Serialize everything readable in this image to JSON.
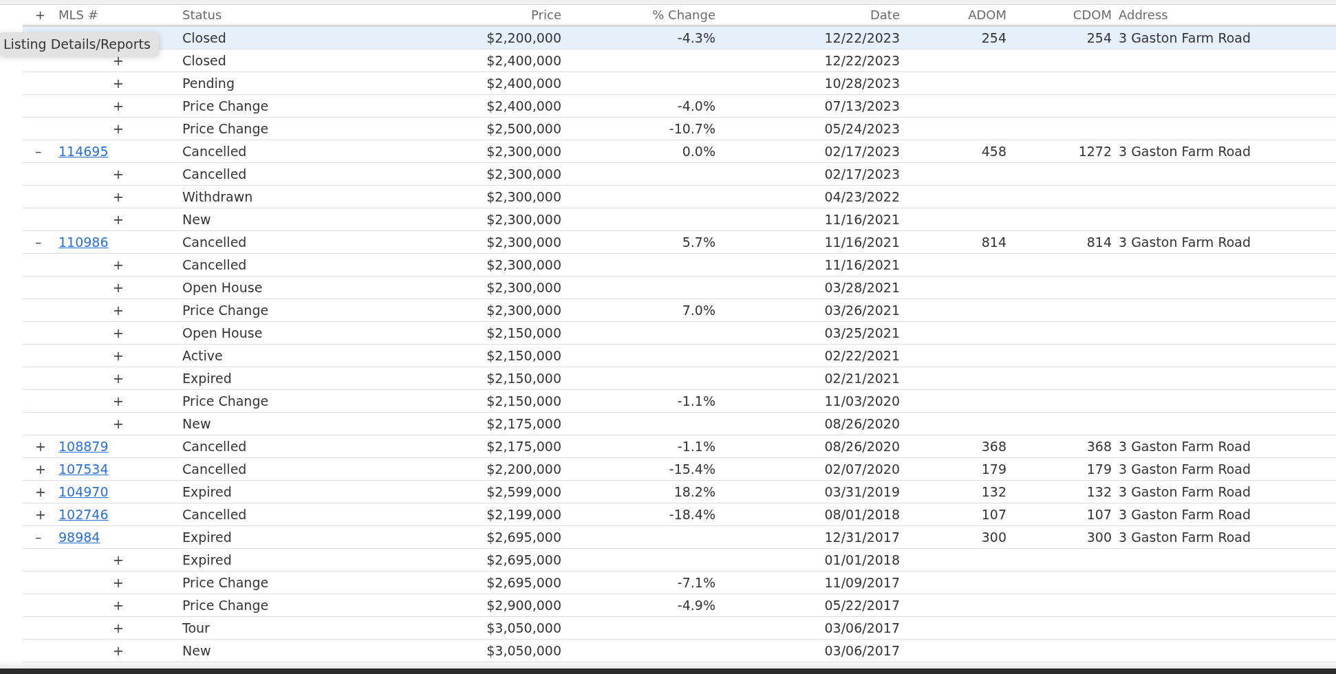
{
  "table": {
    "header": {
      "toggle": "+",
      "columns": [
        "MLS #",
        "Status",
        "Price",
        "% Change",
        "Date",
        "ADOM",
        "CDOM",
        "Address"
      ]
    },
    "listings": [
      {
        "selected": true,
        "status": "Closed",
        "price": "$2,200,000",
        "change": "-4.3%",
        "date": "12/22/2023",
        "adom": "254",
        "cdom": "254",
        "address": "3 Gaston Farm Road",
        "children": [
          {
            "toggle": "+",
            "selected": false,
            "status": "Closed",
            "price": "$2,400,000",
            "date": "12/22/2023"
          },
          {
            "toggle": "+",
            "selected": false,
            "status": "Pending",
            "price": "$2,400,000",
            "date": "10/28/2023"
          },
          {
            "toggle": "+",
            "selected": false,
            "status": "Price Change",
            "price": "$2,400,000",
            "change": "-4.0%",
            "date": "07/13/2023"
          },
          {
            "toggle": "+",
            "selected": false,
            "status": "Price Change",
            "price": "$2,500,000",
            "change": "-10.7%",
            "date": "05/24/2023"
          }
        ]
      },
      {
        "toggle": "–",
        "mls": "114695",
        "selected": false,
        "status": "Cancelled",
        "price": "$2,300,000",
        "change": "0.0%",
        "date": "02/17/2023",
        "adom": "458",
        "cdom": "1272",
        "address": "3 Gaston Farm Road",
        "children": [
          {
            "toggle": "+",
            "selected": false,
            "status": "Cancelled",
            "price": "$2,300,000",
            "date": "02/17/2023"
          },
          {
            "toggle": "+",
            "selected": false,
            "status": "Withdrawn",
            "price": "$2,300,000",
            "date": "04/23/2022"
          },
          {
            "toggle": "+",
            "selected": false,
            "status": "New",
            "price": "$2,300,000",
            "date": "11/16/2021"
          }
        ]
      },
      {
        "toggle": "–",
        "mls": "110986",
        "selected": false,
        "status": "Cancelled",
        "price": "$2,300,000",
        "change": "5.7%",
        "date": "11/16/2021",
        "adom": "814",
        "cdom": "814",
        "address": "3 Gaston Farm Road",
        "children": [
          {
            "toggle": "+",
            "selected": false,
            "status": "Cancelled",
            "price": "$2,300,000",
            "date": "11/16/2021"
          },
          {
            "toggle": "+",
            "selected": false,
            "status": "Open House",
            "price": "$2,300,000",
            "date": "03/28/2021"
          },
          {
            "toggle": "+",
            "selected": false,
            "status": "Price Change",
            "price": "$2,300,000",
            "change": "7.0%",
            "date": "03/26/2021"
          },
          {
            "toggle": "+",
            "selected": false,
            "status": "Open House",
            "price": "$2,150,000",
            "date": "03/25/2021"
          },
          {
            "toggle": "+",
            "selected": false,
            "status": "Active",
            "price": "$2,150,000",
            "date": "02/22/2021"
          },
          {
            "toggle": "+",
            "selected": false,
            "status": "Expired",
            "price": "$2,150,000",
            "date": "02/21/2021"
          },
          {
            "toggle": "+",
            "selected": false,
            "status": "Price Change",
            "price": "$2,150,000",
            "change": "-1.1%",
            "date": "11/03/2020"
          },
          {
            "toggle": "+",
            "selected": false,
            "status": "New",
            "price": "$2,175,000",
            "date": "08/26/2020"
          }
        ]
      },
      {
        "toggle": "+",
        "mls": "108879",
        "selected": false,
        "status": "Cancelled",
        "price": "$2,175,000",
        "change": "-1.1%",
        "date": "08/26/2020",
        "adom": "368",
        "cdom": "368",
        "address": "3 Gaston Farm Road"
      },
      {
        "toggle": "+",
        "mls": "107534",
        "selected": false,
        "status": "Cancelled",
        "price": "$2,200,000",
        "change": "-15.4%",
        "date": "02/07/2020",
        "adom": "179",
        "cdom": "179",
        "address": "3 Gaston Farm Road"
      },
      {
        "toggle": "+",
        "mls": "104970",
        "selected": false,
        "status": "Expired",
        "price": "$2,599,000",
        "change": "18.2%",
        "date": "03/31/2019",
        "adom": "132",
        "cdom": "132",
        "address": "3 Gaston Farm Road"
      },
      {
        "toggle": "+",
        "mls": "102746",
        "selected": false,
        "status": "Cancelled",
        "price": "$2,199,000",
        "change": "-18.4%",
        "date": "08/01/2018",
        "adom": "107",
        "cdom": "107",
        "address": "3 Gaston Farm Road"
      },
      {
        "toggle": "–",
        "mls": "98984",
        "selected": false,
        "status": "Expired",
        "price": "$2,695,000",
        "date": "12/31/2017",
        "adom": "300",
        "cdom": "300",
        "address": "3 Gaston Farm Road",
        "children": [
          {
            "toggle": "+",
            "selected": false,
            "status": "Expired",
            "price": "$2,695,000",
            "date": "01/01/2018"
          },
          {
            "toggle": "+",
            "selected": false,
            "status": "Price Change",
            "price": "$2,695,000",
            "change": "-7.1%",
            "date": "11/09/2017"
          },
          {
            "toggle": "+",
            "selected": false,
            "status": "Price Change",
            "price": "$2,900,000",
            "change": "-4.9%",
            "date": "05/22/2017"
          },
          {
            "toggle": "+",
            "selected": false,
            "status": "Tour",
            "price": "$3,050,000",
            "date": "03/06/2017"
          },
          {
            "toggle": "+",
            "selected": false,
            "status": "New",
            "price": "$3,050,000",
            "date": "03/06/2017"
          }
        ]
      }
    ]
  },
  "tooltip": {
    "text": "Listing Details/Reports"
  }
}
